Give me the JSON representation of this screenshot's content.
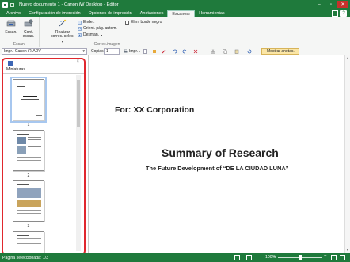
{
  "window": {
    "title": "Nuevo documento 1 - Canon iW Desktop - Editor"
  },
  "tabs": [
    {
      "label": "Archivo"
    },
    {
      "label": "Configuración de impresión"
    },
    {
      "label": "Opciones de impresión"
    },
    {
      "label": "Anotaciones"
    },
    {
      "label": "Escanear",
      "active": true
    },
    {
      "label": "Herramientas"
    }
  ],
  "ribbon": {
    "scan_group": {
      "label": "Escan.",
      "scan_button": "Escan.",
      "config_button_line1": "Conf.",
      "config_button_line2": "escan."
    },
    "correct_group": {
      "label": "Correc.imagen",
      "correct_selection_line1": "Realizar",
      "correct_selection_line2": "correc. selec.",
      "straighten": "Ender.",
      "auto_orient": "Orient. pág. autom.",
      "despeckle": "Desman.",
      "remove_black_border": "Elim. borde negro"
    }
  },
  "toolbar": {
    "printer": "Impr.: Canon iR-ADV",
    "copies_label": "Copias:",
    "copies_value": "1",
    "print_label": "Impr.",
    "show_annotations": "Mostrar anotac."
  },
  "thumbnail_panel": {
    "title": "Miniaturas",
    "pages": [
      {
        "number": "1"
      },
      {
        "number": "2"
      },
      {
        "number": "3"
      }
    ]
  },
  "document": {
    "line1": "For: XX Corporation",
    "title": "Summary of Research",
    "subtitle": "The Future Development of “DE LA CIUDAD LUNA”"
  },
  "status": {
    "text": "Página seleccionada: 1/3",
    "zoom": "100%",
    "zoom_level": 0.5
  },
  "colors": {
    "accent": "#1f7a3c",
    "highlight": "#e0282e"
  }
}
